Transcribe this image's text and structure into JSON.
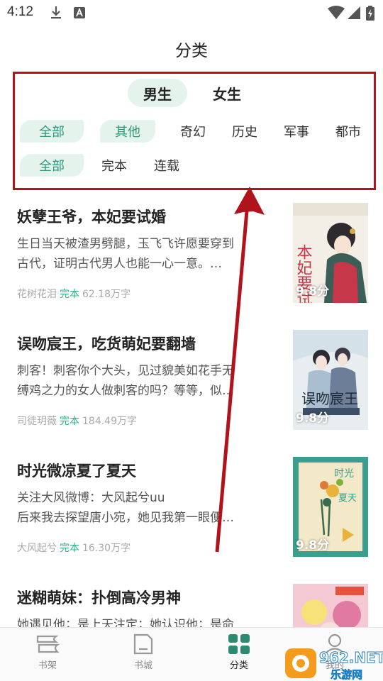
{
  "status_bar": {
    "time": "4:12"
  },
  "page_title": "分类",
  "gender_tabs": [
    {
      "label": "男生",
      "active": true
    },
    {
      "label": "女生",
      "active": false
    }
  ],
  "genre_filters": [
    {
      "label": "全部",
      "active": true
    },
    {
      "label": "其他",
      "active": true
    },
    {
      "label": "奇幻",
      "active": false
    },
    {
      "label": "历史",
      "active": false
    },
    {
      "label": "军事",
      "active": false
    },
    {
      "label": "都市",
      "active": false
    }
  ],
  "status_filters": [
    {
      "label": "全部",
      "active": true
    },
    {
      "label": "完本",
      "active": false
    },
    {
      "label": "连载",
      "active": false
    }
  ],
  "books": [
    {
      "title": "妖孽王爷，本妃要试婚",
      "desc_line1": "生日当天被渣男劈腿，玉飞飞许愿要穿到",
      "desc_line2": "古代，证明古代男人也能一心一意。…",
      "author": "花树花泪",
      "state": "完本",
      "words": "62.18万字",
      "score": "9.8分",
      "cover_text": "本妃要试婚",
      "cover_colors": [
        "#f4efe6",
        "#c6374a",
        "#3b5f57"
      ]
    },
    {
      "title": "误吻宸王，吃货萌妃要翻墙",
      "desc_line1": "刺客！刺客你个大头，见过貌美如花手无",
      "desc_line2": "缚鸡之力的女人做刺客的吗？等等，似…",
      "author": "司徒玥薇",
      "state": "完本",
      "words": "184.49万字",
      "score": "9.8分",
      "cover_text": "误吻宸王",
      "cover_colors": [
        "#e8eef0",
        "#6d7f98",
        "#a9bfd0"
      ]
    },
    {
      "title": "时光微凉夏了夏天",
      "desc_line1": "关注大风微博：大风起兮uu",
      "desc_line2": "后来我去探望唐小宛，她见我第一眼便…",
      "author": "大风起兮",
      "state": "完本",
      "words": "16.30万字",
      "score": "9.8分",
      "cover_text": "时光 夏天",
      "cover_colors": [
        "#3b9f8f",
        "#f3e8c8",
        "#e8b33b"
      ]
    },
    {
      "title": "迷糊萌妹：扑倒高冷男神",
      "desc_line1": "她遇见他；是上天注定；她认识他；是命",
      "desc_line2": "",
      "author": "",
      "state": "",
      "words": "",
      "score": "",
      "cover_text": "",
      "cover_colors": [
        "#f5c9d4",
        "#e07aa0",
        "#f7e27a"
      ]
    }
  ],
  "bottom_nav": [
    {
      "label": "书架",
      "icon": "bookshelf-icon",
      "active": false
    },
    {
      "label": "书城",
      "icon": "bookstore-icon",
      "active": false
    },
    {
      "label": "分类",
      "icon": "category-icon",
      "active": true
    },
    {
      "label": "我的",
      "icon": "profile-icon",
      "active": false
    }
  ],
  "watermark": {
    "brand": "962.NET",
    "sub": "乐游网"
  },
  "colors": {
    "accent": "#2c9a79",
    "chip_bg": "#e4f3ec",
    "annotation_red": "#b1131c"
  }
}
